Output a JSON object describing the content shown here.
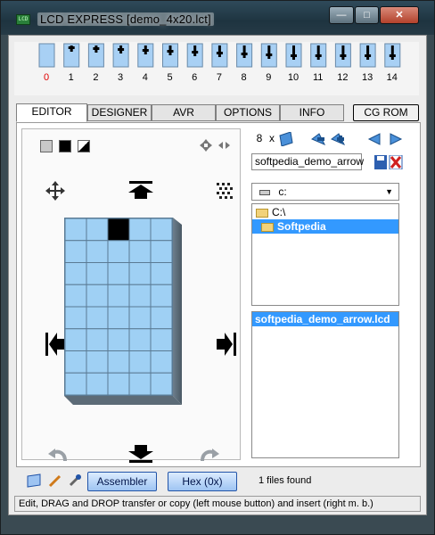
{
  "window": {
    "title": "LCD EXPRESS  [demo_4x20.lct]",
    "app_icon_text": "LCD"
  },
  "char_strip": {
    "selected_index": 0,
    "numbers": [
      "0",
      "1",
      "2",
      "3",
      "4",
      "5",
      "6",
      "7",
      "8",
      "9",
      "10",
      "11",
      "12",
      "13",
      "14"
    ]
  },
  "tabs": {
    "items": [
      "EDITOR",
      "DESIGNER",
      "AVR",
      "OPTIONS",
      "INFO"
    ],
    "active": "EDITOR",
    "cg_rom": "CG ROM"
  },
  "right": {
    "count_value": "8",
    "count_sep": "x",
    "filename": "softpedia_demo_arrow",
    "drive": "c:",
    "dirs": [
      "C:\\",
      "Softpedia"
    ],
    "selected_dir": "Softpedia",
    "files": [
      "softpedia_demo_arrow.lcd"
    ]
  },
  "bottom": {
    "assembler_label": "Assembler",
    "hex_label": "Hex (0x)",
    "files_found": "1 files found"
  },
  "statusbar": {
    "text": "Edit, DRAG and DROP transfer or copy (left mouse button) and insert (right m. b.)"
  },
  "colors": {
    "grid_fill": "#9fd0f4",
    "selected_number": "#e00000",
    "selection": "#3399ff"
  }
}
